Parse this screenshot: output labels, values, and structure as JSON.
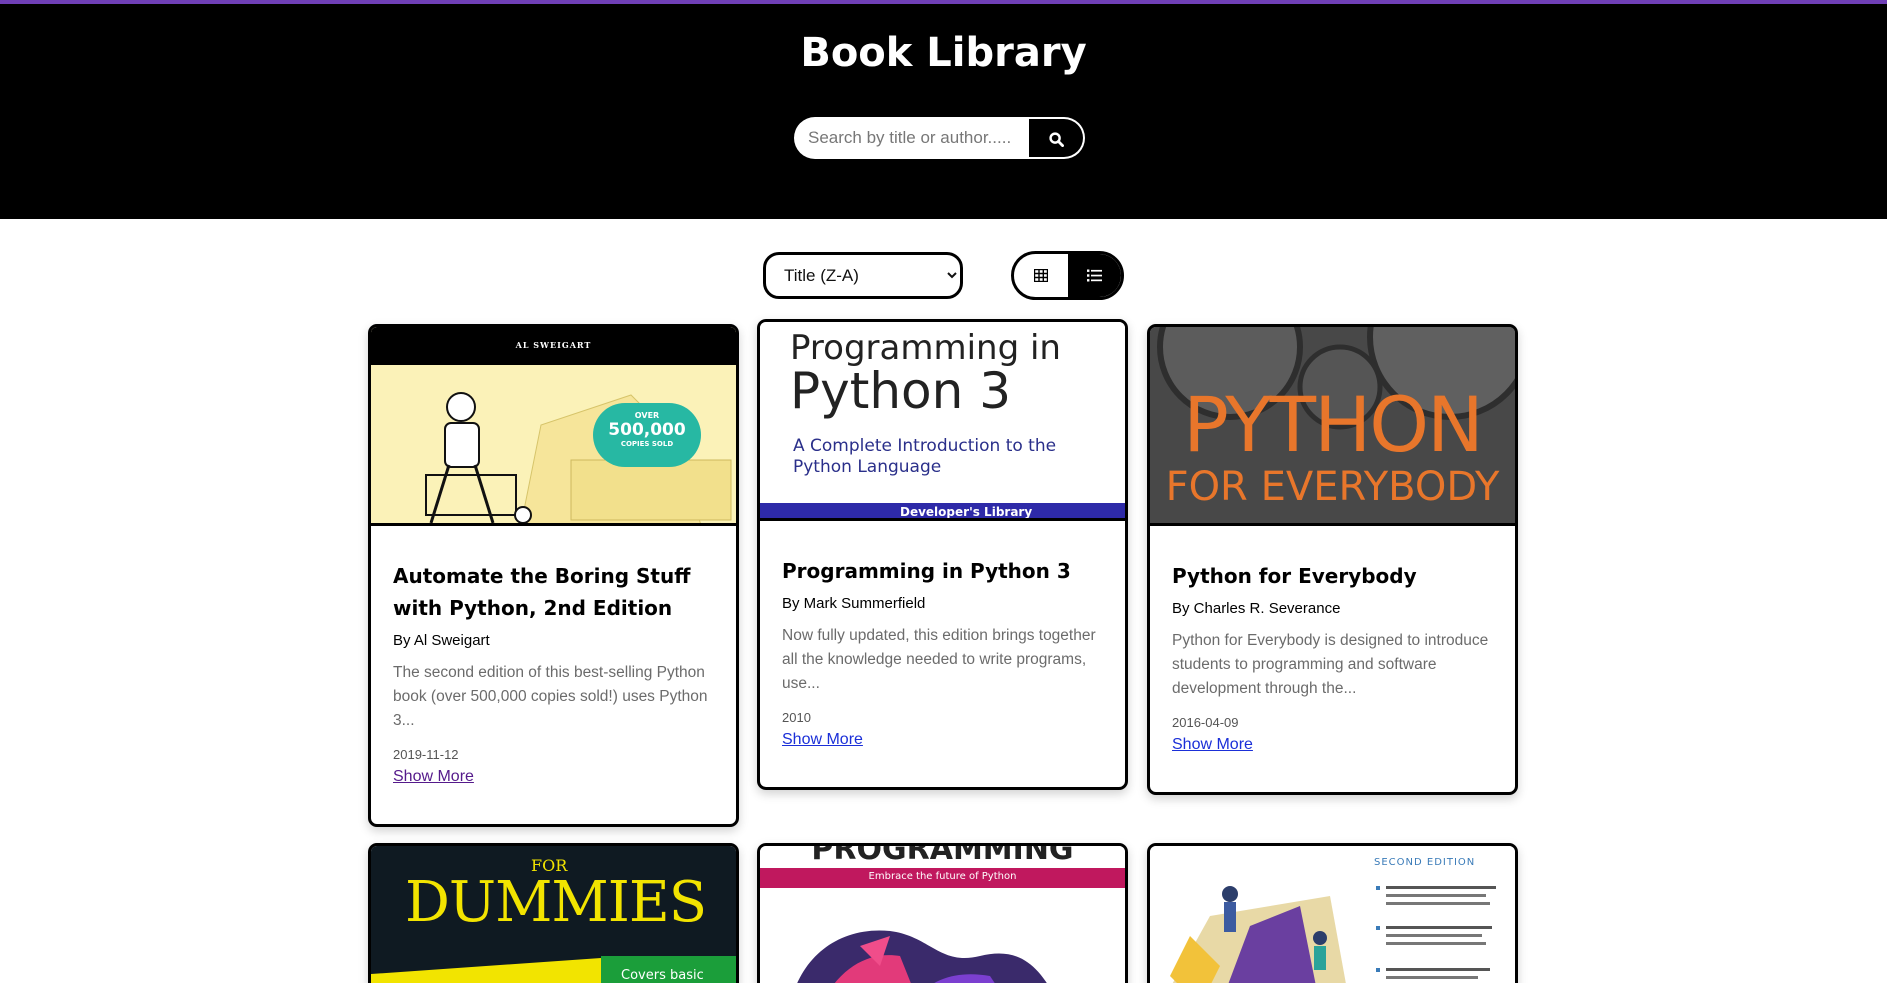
{
  "header": {
    "title": "Book Library",
    "search_placeholder": "Search by title or author.....",
    "search_icon": "search-icon"
  },
  "controls": {
    "sort_selected": "Title (Z-A)",
    "view_grid_icon": "grid-icon",
    "view_list_icon": "list-icon",
    "active_view": "list"
  },
  "books": [
    {
      "cover_header": "AL SWEIGART",
      "cover_badge": [
        "OVER",
        "500,000",
        "COPIES SOLD"
      ],
      "title": "Automate the Boring Stuff with Python, 2nd Edition",
      "author": "By Al Sweigart",
      "description": "The second edition of this best-selling Python book (over 500,000 copies sold!) uses Python 3...",
      "date": "2019-11-12",
      "link": "Show More"
    },
    {
      "cover_line1": "Programming in",
      "cover_line2": "Python 3",
      "cover_sub1": "A Complete Introduction to the",
      "cover_sub2": "Python Language",
      "cover_band": "Developer's Library",
      "title": "Programming in Python 3",
      "author": "By Mark Summerfield",
      "description": "Now fully updated, this edition brings together all the knowledge needed to write programs, use...",
      "date": "2010",
      "link": "Show More"
    },
    {
      "cover_line1": "PYTHON",
      "cover_line2": "FOR EVERYBODY",
      "title": "Python for Everybody",
      "author": "By Charles R. Severance",
      "description": "Python for Everybody is designed to introduce students to programming and software development through the...",
      "date": "2016-04-09",
      "link": "Show More"
    },
    {
      "cover_for": "FOR",
      "cover_main": "DUMMIES",
      "cover_band": "Covers basic"
    },
    {
      "cover_main": "PROGRAMMING",
      "cover_band": "Embrace the future of Python"
    },
    {
      "cover_edition": "SECOND EDITION"
    }
  ],
  "colors": {
    "header_bg": "#000000",
    "accent_top": "#6f3fb6",
    "link": "#1b2fd8",
    "link_visited": "#551a8b",
    "python_orange": "#e8762b"
  }
}
